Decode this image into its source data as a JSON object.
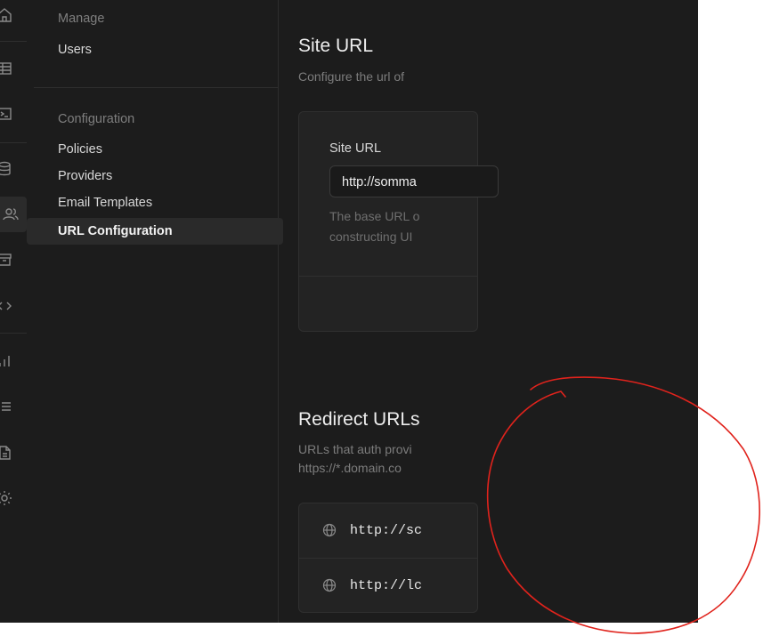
{
  "rail": {
    "icons": [
      "home-icon",
      "table-icon",
      "terminal-icon",
      "database-icon",
      "users-icon",
      "archive-icon",
      "code-icon",
      "bar-chart-icon",
      "list-icon",
      "document-icon",
      "gear-icon"
    ],
    "active": "users-icon"
  },
  "menu": {
    "manage_heading": "Manage",
    "manage_items": [
      "Users"
    ],
    "config_heading": "Configuration",
    "config_items": [
      "Policies",
      "Providers",
      "Email Templates",
      "URL Configuration"
    ],
    "active_item": "URL Configuration"
  },
  "site_url": {
    "title": "Site URL",
    "description": "Configure the url of",
    "field_label": "Site URL",
    "field_value": "http://somma",
    "help_line1": "The base URL o",
    "help_line2": "constructing UI"
  },
  "redirect_urls": {
    "title": "Redirect URLs",
    "description_line1": "URLs that auth provi",
    "description_line2": "https://*.domain.co",
    "items": [
      "http://sc",
      "http://lc"
    ]
  },
  "colors": {
    "background": "#1c1c1c",
    "annotation": "#e0231c"
  }
}
